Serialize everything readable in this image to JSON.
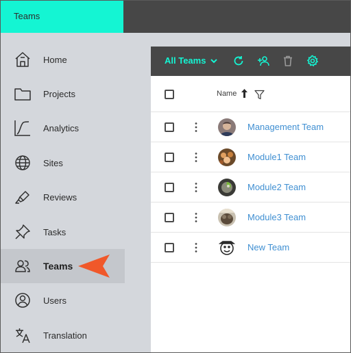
{
  "topbar": {
    "tab_label": "Teams"
  },
  "sidebar": {
    "items": [
      {
        "label": "Home",
        "icon": "home-icon"
      },
      {
        "label": "Projects",
        "icon": "folder-icon"
      },
      {
        "label": "Analytics",
        "icon": "analytics-icon"
      },
      {
        "label": "Sites",
        "icon": "globe-icon"
      },
      {
        "label": "Reviews",
        "icon": "highlighter-icon"
      },
      {
        "label": "Tasks",
        "icon": "pin-icon"
      },
      {
        "label": "Teams",
        "icon": "people-icon",
        "active": true
      },
      {
        "label": "Users",
        "icon": "user-circle-icon"
      },
      {
        "label": "Translation",
        "icon": "translate-icon"
      }
    ]
  },
  "toolbar": {
    "filter_label": "All Teams",
    "icons": [
      "refresh-icon",
      "add-user-icon",
      "trash-icon",
      "gear-icon"
    ]
  },
  "table": {
    "column_name": "Name",
    "sort_direction": "ascending",
    "rows": [
      {
        "name": "Management Team"
      },
      {
        "name": "Module1 Team"
      },
      {
        "name": "Module2 Team"
      },
      {
        "name": "Module3 Team"
      },
      {
        "name": "New Team"
      }
    ]
  },
  "colors": {
    "accent": "#14f5d3",
    "topbar": "#474747",
    "sidebar": "#d4d7dc",
    "link": "#3f8fd2",
    "callout_arrow": "#f0582a"
  }
}
